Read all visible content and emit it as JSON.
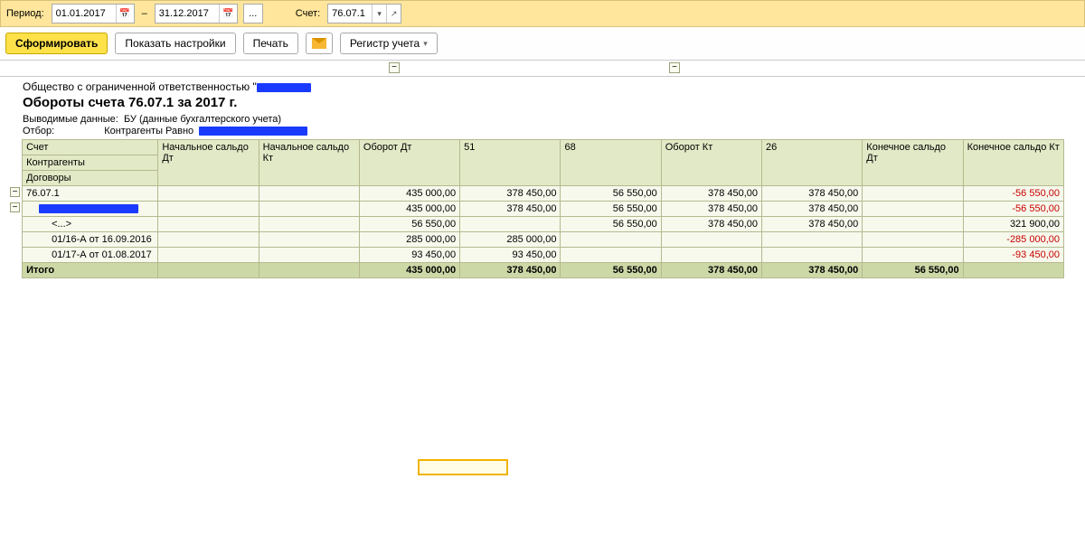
{
  "period": {
    "label": "Период:",
    "from": "01.01.2017",
    "to": "31.12.2017",
    "dash": "–",
    "ellipsis": "...",
    "account_label": "Счет:",
    "account_value": "76.07.1"
  },
  "toolbar": {
    "form": "Сформировать",
    "show_settings": "Показать настройки",
    "print": "Печать",
    "register": "Регистр учета"
  },
  "header": {
    "org_prefix": "Общество с ограниченной ответственностью \"",
    "title": "Обороты счета 76.07.1 за 2017 г.",
    "output_label": "Выводимые данные:",
    "output_value": "БУ (данные бухгалтерского учета)",
    "filter_label": "Отбор:",
    "filter_value": "Контрагенты Равно"
  },
  "columns": {
    "acc1": "Счет",
    "acc2": "Контрагенты",
    "acc3": "Договоры",
    "beg_dt": "Начальное сальдо Дт",
    "beg_kt": "Начальное сальдо Кт",
    "turn_dt": "Оборот Дт",
    "c51": "51",
    "c68": "68",
    "turn_kt": "Оборот Кт",
    "c26": "26",
    "end_dt": "Конечное сальдо Дт",
    "end_kt": "Конечное сальдо Кт"
  },
  "rows": [
    {
      "label": "76.07.1",
      "turn_dt": "435 000,00",
      "c51": "378 450,00",
      "c68": "56 550,00",
      "turn_kt": "378 450,00",
      "c26": "378 450,00",
      "end_kt": "-56 550,00",
      "neg_end": true,
      "expand": true
    },
    {
      "label": "",
      "redacted": true,
      "turn_dt": "435 000,00",
      "c51": "378 450,00",
      "c68": "56 550,00",
      "turn_kt": "378 450,00",
      "c26": "378 450,00",
      "end_kt": "-56 550,00",
      "neg_end": true,
      "expand": true,
      "indent": 1
    },
    {
      "label": "<...>",
      "turn_dt": "56 550,00",
      "c68": "56 550,00",
      "turn_kt": "378 450,00",
      "c26": "378 450,00",
      "end_kt": "321 900,00",
      "indent": 2
    },
    {
      "label": "01/16-А от 16.09.2016",
      "turn_dt": "285 000,00",
      "c51": "285 000,00",
      "end_kt": "-285 000,00",
      "neg_end": true,
      "indent": 2
    },
    {
      "label": "01/17-А от 01.08.2017",
      "turn_dt": "93 450,00",
      "c51": "93 450,00",
      "end_kt": "-93 450,00",
      "neg_end": true,
      "indent": 2
    }
  ],
  "total": {
    "label": "Итого",
    "turn_dt": "435 000,00",
    "c51": "378 450,00",
    "c68": "56 550,00",
    "turn_kt": "378 450,00",
    "c26": "378 450,00",
    "end_dt": "56 550,00"
  }
}
